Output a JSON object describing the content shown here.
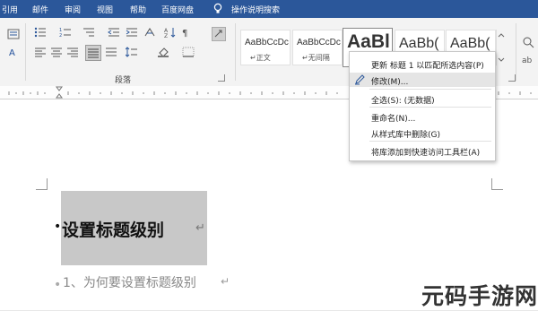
{
  "menubar": {
    "tabs": [
      "引用",
      "邮件",
      "审阅",
      "视图",
      "帮助",
      "百度网盘"
    ],
    "tell_me": "操作说明搜索"
  },
  "ribbon": {
    "paragraph_group_label": "段落",
    "styles": [
      {
        "preview": "AaBbCcDc",
        "name": "↵正文"
      },
      {
        "preview": "AaBbCcDc",
        "name": "↵无间隔"
      },
      {
        "preview": "AaBl",
        "name": ""
      },
      {
        "preview": "AaBb(",
        "name": ""
      },
      {
        "preview": "AaBb(",
        "name": ""
      }
    ]
  },
  "context_menu": {
    "items": [
      {
        "label": "更新 标题 1 以匹配所选内容(P)",
        "icon": ""
      },
      {
        "label": "修改(M)...",
        "icon": "pen-icon"
      },
      {
        "label": "全选(S): (无数据)",
        "icon": ""
      },
      {
        "label": "重命名(N)...",
        "icon": ""
      },
      {
        "label": "从样式库中删除(G)",
        "icon": ""
      },
      {
        "label": "将库添加到快速访问工具栏(A)",
        "icon": ""
      }
    ]
  },
  "document": {
    "heading": "设置标题级别",
    "line2": "1、为何要设置标题级别"
  },
  "watermark": "元码手游网",
  "colors": {
    "title_bar": "#2b579a",
    "selection": "#c8c8c8",
    "hover": "#e5e5e5"
  }
}
